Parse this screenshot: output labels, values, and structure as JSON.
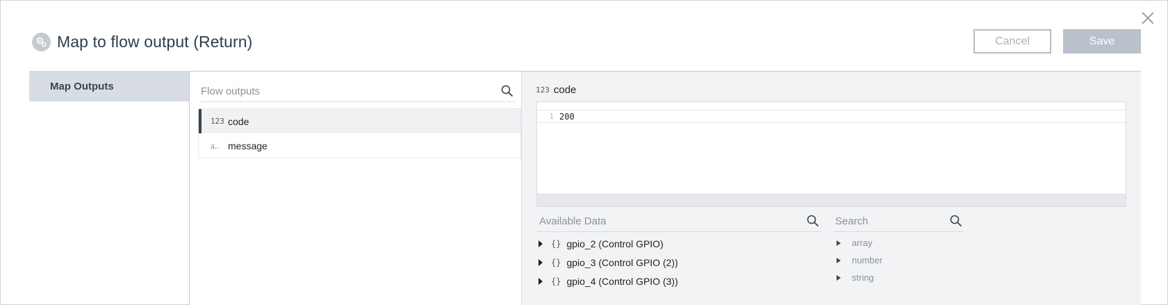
{
  "dialog": {
    "title": "Map to flow output (Return)",
    "title_icon": "gear-icon",
    "close_icon": "close-icon"
  },
  "actions": {
    "cancel_label": "Cancel",
    "save_label": "Save"
  },
  "sidebar": {
    "items": [
      {
        "label": "Map Outputs",
        "selected": true
      }
    ]
  },
  "flow_outputs": {
    "search_placeholder": "Flow outputs",
    "items": [
      {
        "type_icon": "123",
        "label": "code",
        "selected": true
      },
      {
        "type_icon": "a..",
        "label": "message",
        "selected": false
      }
    ]
  },
  "editor": {
    "field_type_icon": "123",
    "field_name": "code",
    "lines": [
      {
        "number": "1",
        "value": "200"
      }
    ]
  },
  "available_data": {
    "search_placeholder": "Available Data",
    "items": [
      {
        "icon": "{}",
        "label": "gpio_2 (Control GPIO)"
      },
      {
        "icon": "{}",
        "label": "gpio_3 (Control GPIO (2))"
      },
      {
        "icon": "{}",
        "label": "gpio_4 (Control GPIO (3))"
      }
    ]
  },
  "types": {
    "search_placeholder": "Search",
    "items": [
      {
        "label": "array"
      },
      {
        "label": "number"
      },
      {
        "label": "string"
      }
    ]
  },
  "colors": {
    "sidebar_selected": "#d8dde4",
    "save_button": "#b9c1cc",
    "editor_background": "#f2f3f5"
  }
}
